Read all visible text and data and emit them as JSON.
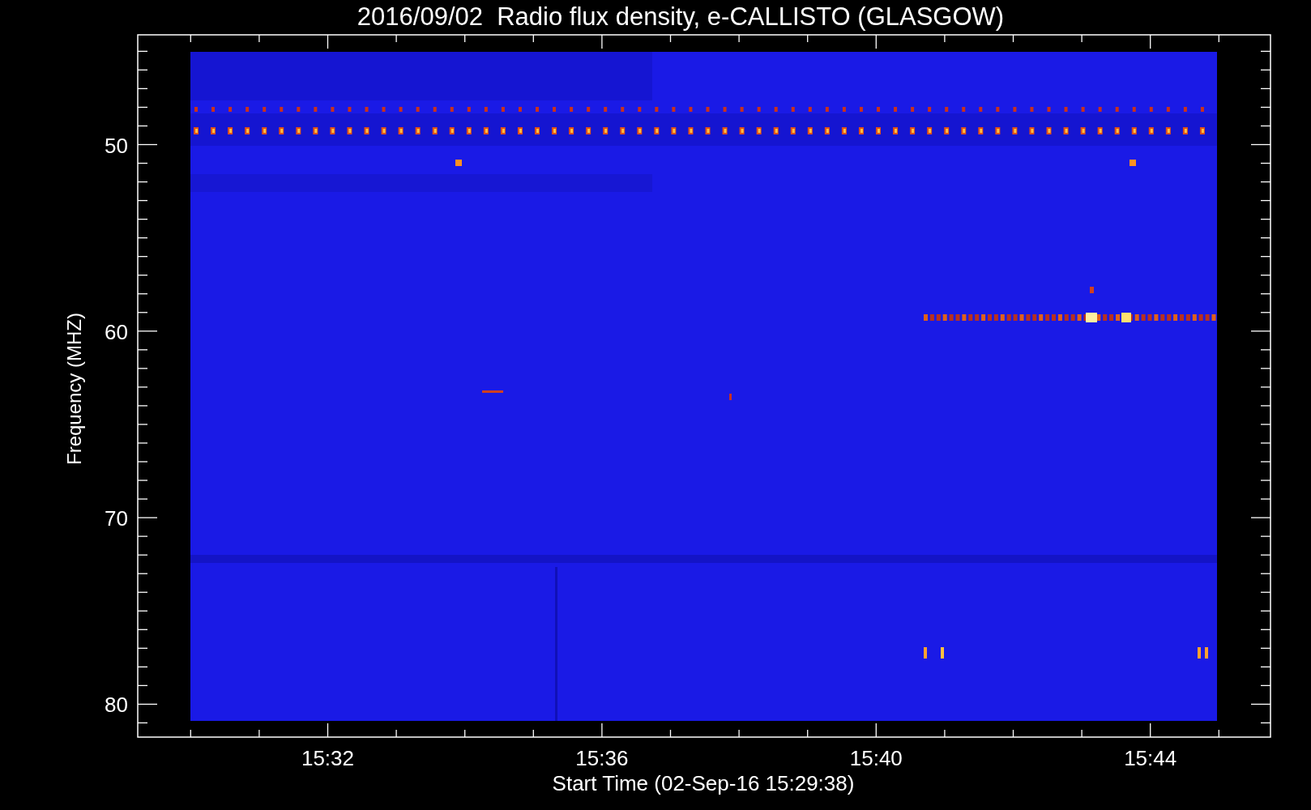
{
  "title": "2016/09/02  Radio flux density, e-CALLISTO (GLASGOW)",
  "y_axis": {
    "title": "Frequency (MHZ)",
    "tick_labels": [
      "50",
      "60",
      "70",
      "80"
    ]
  },
  "x_axis": {
    "title": "Start Time (02-Sep-16 15:29:38)",
    "tick_labels": [
      "15:32",
      "15:36",
      "15:40",
      "15:44"
    ]
  }
}
